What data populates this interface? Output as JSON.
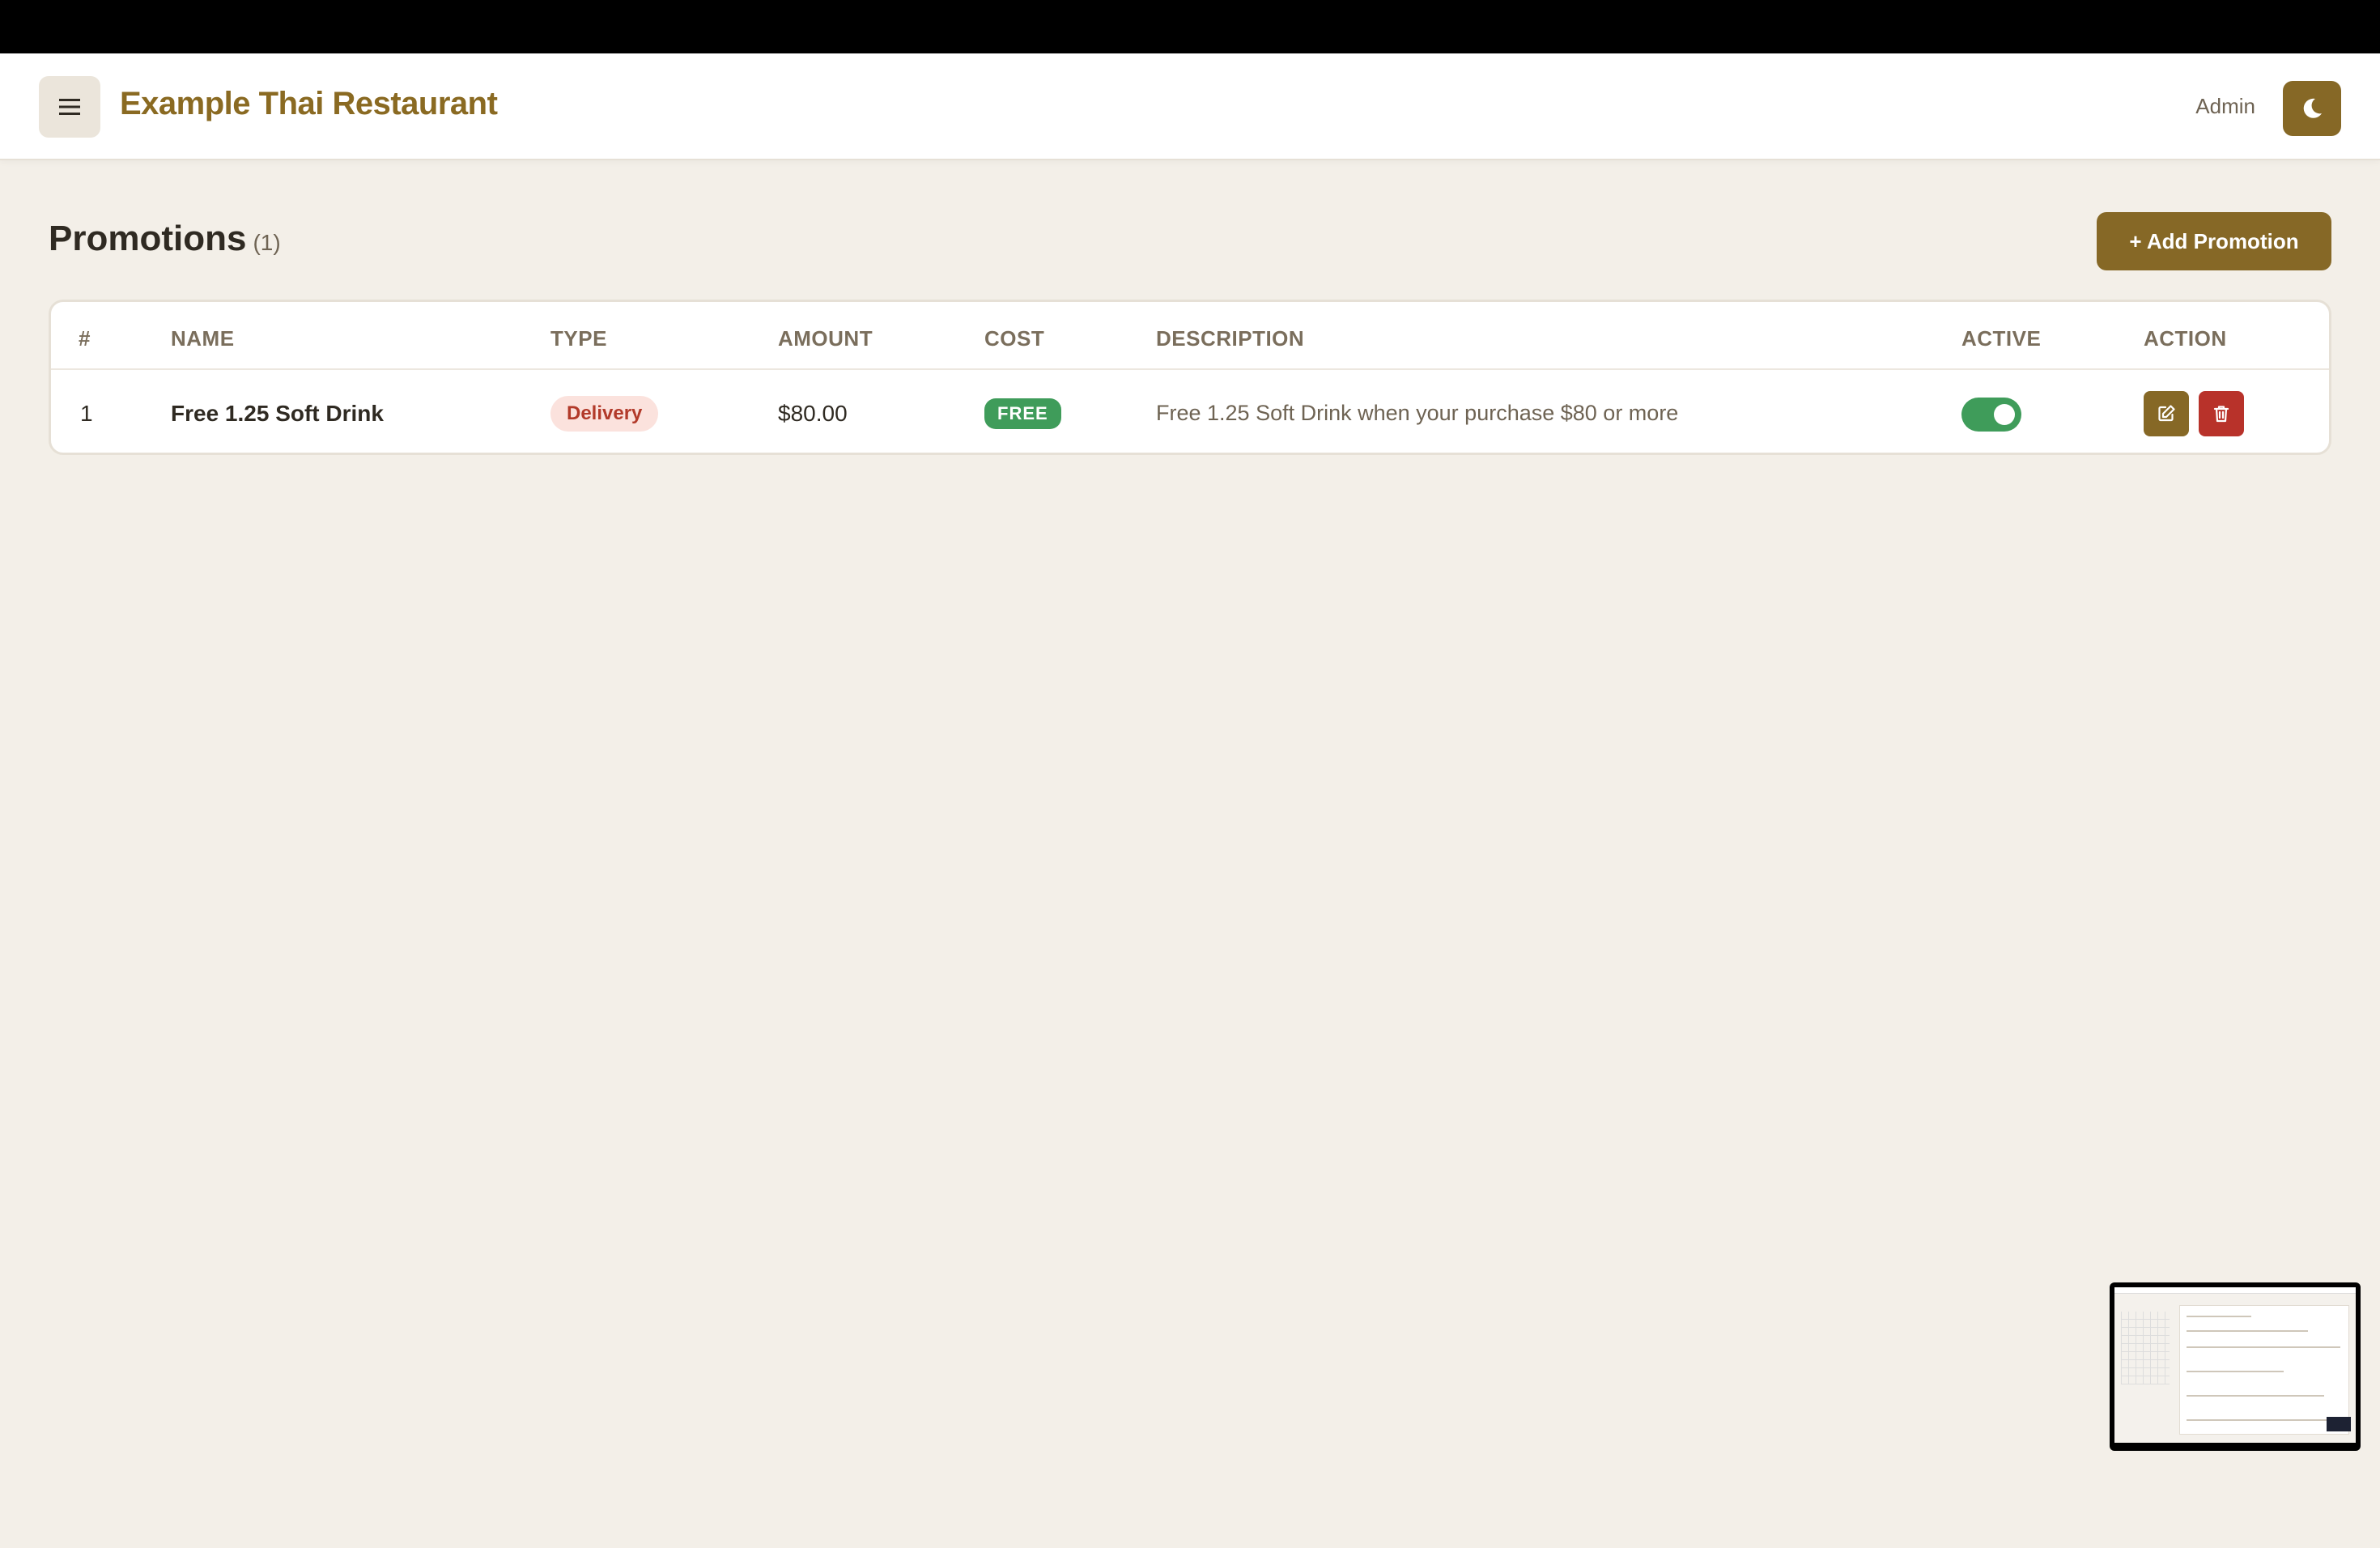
{
  "header": {
    "brand": "Example Thai Restaurant",
    "user_label": "Admin",
    "menu_icon": "hamburger-icon",
    "theme_icon": "moon-icon"
  },
  "page": {
    "title": "Promotions",
    "count": "(1)",
    "add_button": "+ Add Promotion"
  },
  "table": {
    "columns": [
      "#",
      "NAME",
      "TYPE",
      "AMOUNT",
      "COST",
      "DESCRIPTION",
      "ACTIVE",
      "ACTION"
    ],
    "rows": [
      {
        "index": "1",
        "name": "Free 1.25 Soft Drink",
        "type": "Delivery",
        "amount": "$80.00",
        "cost": "FREE",
        "description": "Free 1.25 Soft Drink when your purchase $80 or more",
        "active": true
      }
    ]
  },
  "colors": {
    "accent": "#866826",
    "brand_text": "#8a6a22",
    "success": "#3f9c5a",
    "danger": "#b8322a",
    "background": "#f3efe8"
  }
}
